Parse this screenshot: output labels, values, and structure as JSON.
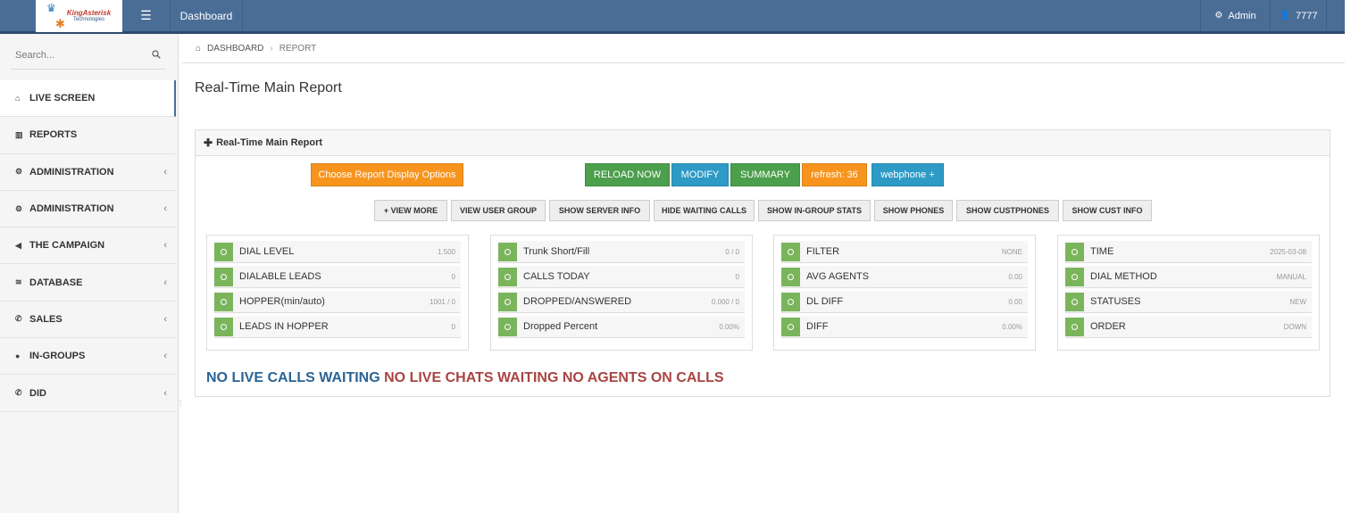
{
  "brand": {
    "logo_main": "KingAsterisk",
    "logo_sub": "Technologies"
  },
  "topbar": {
    "menu_icon": "hamburger-icon",
    "dashboard_label": "Dashboard",
    "admin_label": "Admin",
    "user_label": "7777"
  },
  "sidebar": {
    "search_placeholder": "Search...",
    "items": [
      {
        "label": "LIVE SCREEN",
        "icon": "home-icon"
      },
      {
        "label": "REPORTS",
        "icon": "chart-icon"
      },
      {
        "label": "ADMINISTRATION",
        "icon": "gear-icon"
      },
      {
        "label": "ADMINISTRATION",
        "icon": "gear-icon"
      },
      {
        "label": "THE CAMPAIGN",
        "icon": "megaphone-icon"
      },
      {
        "label": "DATABASE",
        "icon": "database-icon"
      },
      {
        "label": "SALES",
        "icon": "phone-icon"
      },
      {
        "label": "IN-GROUPS",
        "icon": "user-icon"
      },
      {
        "label": "DID",
        "icon": "phone-icon"
      }
    ]
  },
  "breadcrumb": {
    "home": "DASHBOARD",
    "current": "REPORT"
  },
  "page_title": "Real-Time Main Report",
  "panel": {
    "title": "Real-Time Main Report",
    "choose_options": "Choose Report Display Options",
    "reload_now": "RELOAD NOW",
    "modify": "MODIFY",
    "summary": "SUMMARY",
    "refresh": "refresh: 36",
    "webphone": "webphone +",
    "view_buttons": [
      "+ VIEW MORE",
      "VIEW USER GROUP",
      "SHOW SERVER INFO",
      "HIDE WAITING CALLS",
      "SHOW IN-GROUP STATS",
      "SHOW PHONES",
      "SHOW CUSTPHONES",
      "SHOW CUST INFO"
    ]
  },
  "stats": [
    [
      {
        "label": "DIAL LEVEL",
        "value": "1.500"
      },
      {
        "label": "DIALABLE LEADS",
        "value": "0"
      },
      {
        "label": "HOPPER(min/auto)",
        "value": "1001 / 0"
      },
      {
        "label": "LEADS IN HOPPER",
        "value": "0"
      }
    ],
    [
      {
        "label": "Trunk Short/Fill",
        "value": "0 / 0"
      },
      {
        "label": "CALLS TODAY",
        "value": "0"
      },
      {
        "label": "DROPPED/ANSWERED",
        "value": "0.000 / 0"
      },
      {
        "label": "Dropped Percent",
        "value": "0.00%"
      }
    ],
    [
      {
        "label": "FILTER",
        "value": "NONE"
      },
      {
        "label": "AVG AGENTS",
        "value": "0.00"
      },
      {
        "label": "DL DIFF",
        "value": "0.00"
      },
      {
        "label": "DIFF",
        "value": "0.00%"
      }
    ],
    [
      {
        "label": "TIME",
        "value": "2025-03-08"
      },
      {
        "label": "DIAL METHOD",
        "value": "MANUAL"
      },
      {
        "label": "STATUSES",
        "value": "NEW"
      },
      {
        "label": "ORDER",
        "value": "DOWN"
      }
    ]
  ],
  "live_status": {
    "calls": "NO LIVE CALLS WAITING",
    "chats": "NO LIVE CHATS WAITING",
    "agents": "NO AGENTS ON CALLS"
  },
  "colors": {
    "topbar": "#4a6d96",
    "green_button": "#4c9f4c",
    "blue_button": "#2e9ac6",
    "orange_button": "#f7941d",
    "status_blue": "#2a6496",
    "status_red": "#a94442"
  }
}
